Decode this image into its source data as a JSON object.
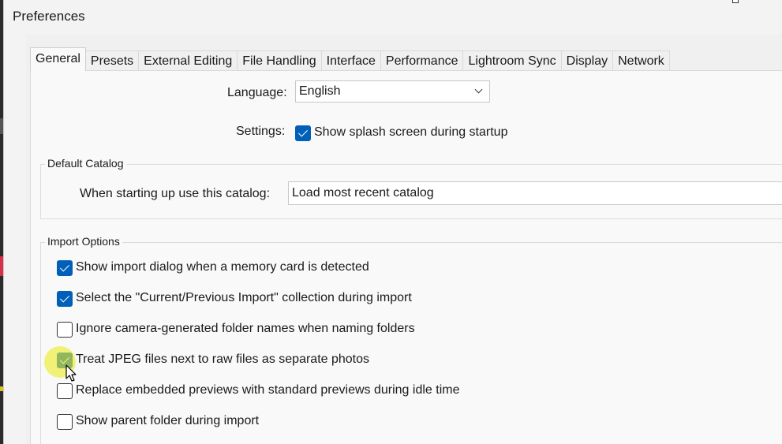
{
  "window": {
    "title": "Preferences"
  },
  "tabs": [
    {
      "label": "General"
    },
    {
      "label": "Presets"
    },
    {
      "label": "External Editing"
    },
    {
      "label": "File Handling"
    },
    {
      "label": "Interface"
    },
    {
      "label": "Performance"
    },
    {
      "label": "Lightroom Sync"
    },
    {
      "label": "Display"
    },
    {
      "label": "Network"
    }
  ],
  "active_tab": "General",
  "general": {
    "language_label": "Language:",
    "language_value": "English",
    "settings_label": "Settings:",
    "splash_label": "Show splash screen during startup",
    "splash_checked": true
  },
  "default_catalog": {
    "legend": "Default Catalog",
    "startup_label": "When starting up use this catalog:",
    "startup_value": "Load most recent catalog"
  },
  "import_options": {
    "legend": "Import Options",
    "items": [
      {
        "label": "Show import dialog when a memory card is detected",
        "checked": true
      },
      {
        "label": "Select the \"Current/Previous Import\" collection during import",
        "checked": true
      },
      {
        "label": "Ignore camera-generated folder names when naming folders",
        "checked": false
      },
      {
        "label": "Treat JPEG files next to raw files as separate photos",
        "checked": true
      },
      {
        "label": "Replace embedded previews with standard previews during idle time",
        "checked": false
      },
      {
        "label": "Show parent folder during import",
        "checked": false
      }
    ]
  },
  "colors": {
    "accent": "#005fb8",
    "cursor_highlight": "#ebeb28"
  }
}
